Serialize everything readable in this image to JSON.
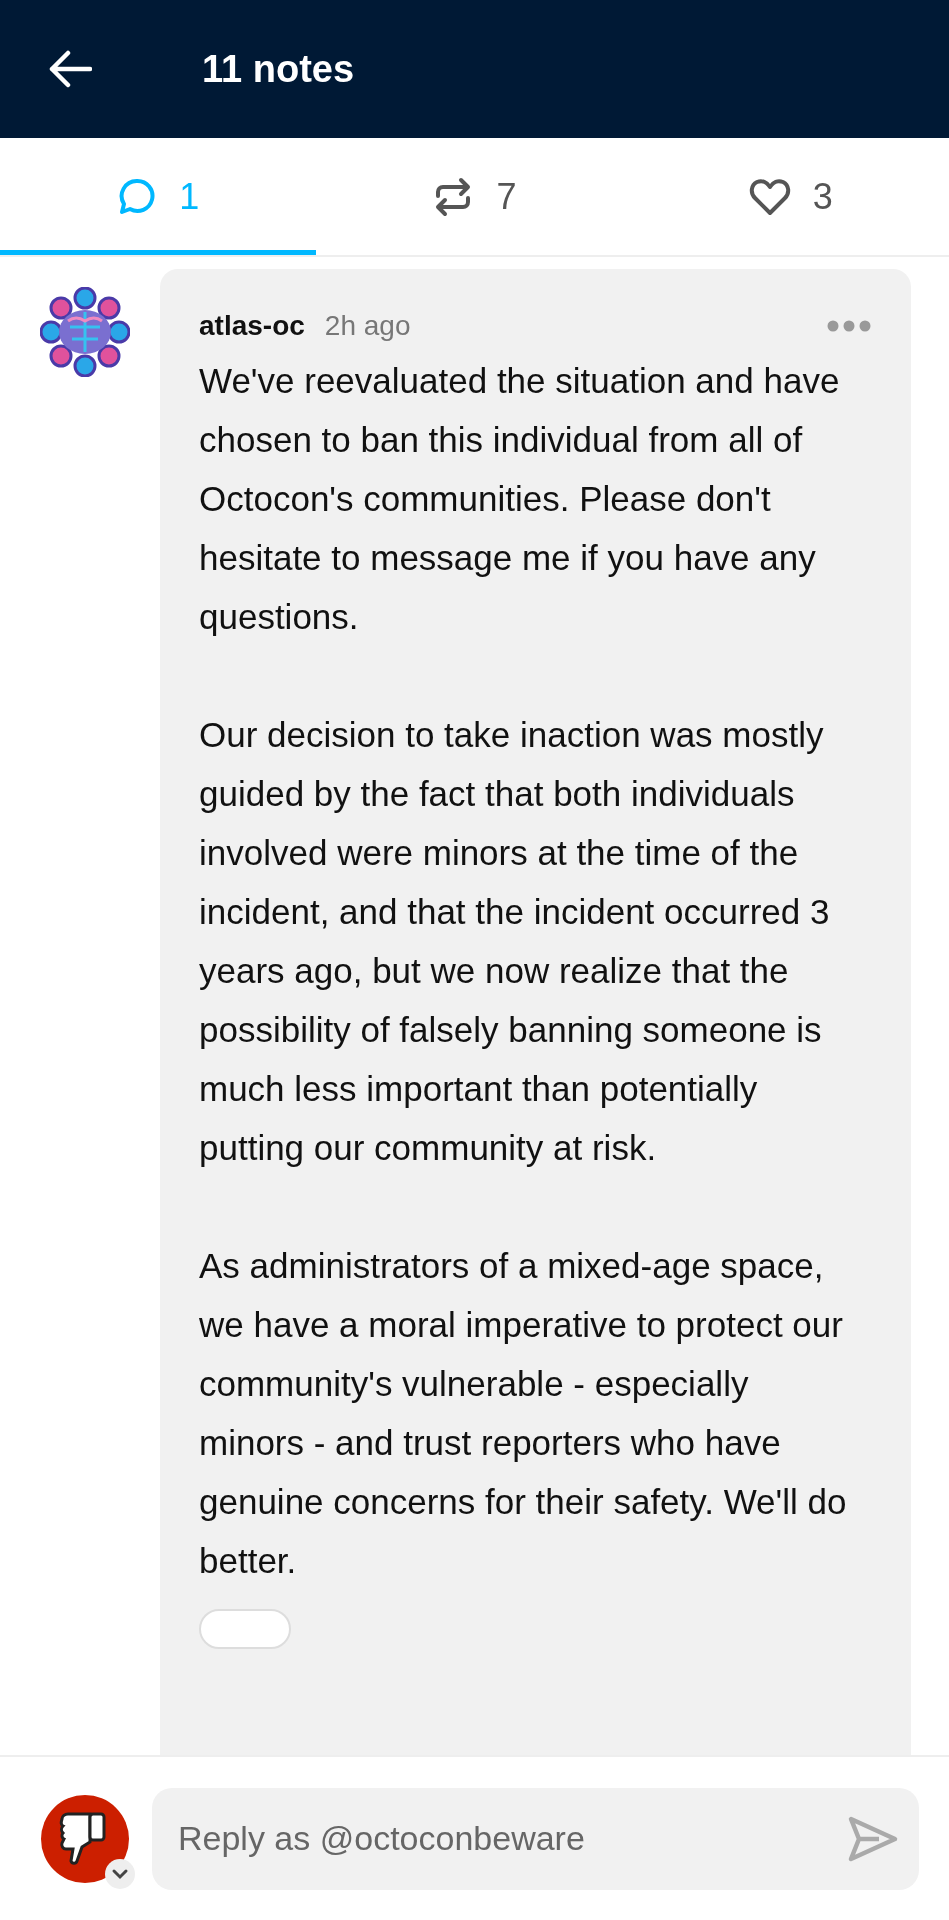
{
  "header": {
    "title": "11 notes"
  },
  "tabs": [
    {
      "kind": "replies",
      "count": "1",
      "selected": true
    },
    {
      "kind": "reblogs",
      "count": "7",
      "selected": false
    },
    {
      "kind": "likes",
      "count": "3",
      "selected": false
    }
  ],
  "comment": {
    "username": "atlas-oc",
    "time": "2h ago",
    "paragraphs": [
      "We've reevaluated the situation and have chosen to ban this individual from all of Octocon's communities. Please don't hesitate to message me if you have any questions.",
      "Our decision to take inaction was mostly guided by the fact that both individuals involved were minors at the time of the incident, and that the incident occurred 3 years ago, but we now realize that the possibility of falsely banning someone is much less important than potentially putting our community at risk.",
      "As administrators of a mixed-age space, we have a moral imperative to protect our community's vulnerable - especially minors - and trust reporters who have genuine concerns for their safety. We'll do better."
    ]
  },
  "reply": {
    "placeholder": "Reply as @octoconbeware"
  }
}
